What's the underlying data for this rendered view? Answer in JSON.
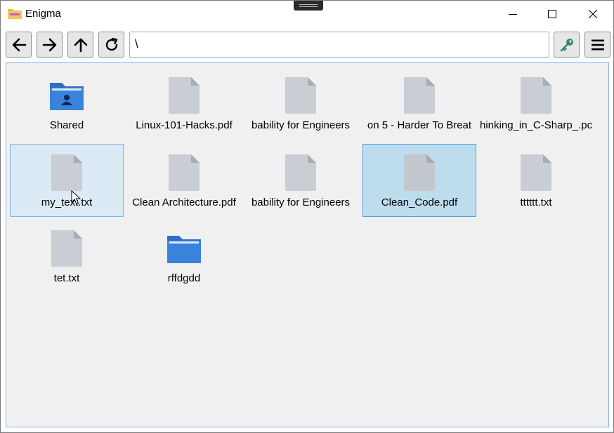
{
  "window": {
    "title": "Enigma"
  },
  "toolbar": {
    "path_value": "\\"
  },
  "items": [
    {
      "label": "Shared",
      "type": "folder-shared"
    },
    {
      "label": "Linux-101-Hacks.pdf",
      "type": "file"
    },
    {
      "label": "bability for Engineers",
      "type": "file"
    },
    {
      "label": "on 5 - Harder To Breat",
      "type": "file"
    },
    {
      "label": "hinking_in_C-Sharp_.pc",
      "type": "file"
    },
    {
      "label": "my_text.txt",
      "type": "file",
      "state": "hover"
    },
    {
      "label": "Clean Architecture.pdf",
      "type": "file"
    },
    {
      "label": "bability for Engineers",
      "type": "file"
    },
    {
      "label": "Clean_Code.pdf",
      "type": "file",
      "state": "selected"
    },
    {
      "label": "tttttt.txt",
      "type": "file"
    },
    {
      "label": "tet.txt",
      "type": "file"
    },
    {
      "label": "rffdgdd",
      "type": "folder"
    }
  ],
  "colors": {
    "folder": "#3a7ad6",
    "file": "#c8ccd3",
    "key_icon": "#3a8a6a",
    "selection": "#bddced",
    "hover": "#dbeaf4"
  },
  "icons": {
    "back": "arrow-left-icon",
    "forward": "arrow-right-icon",
    "up": "arrow-up-icon",
    "refresh": "refresh-icon",
    "key": "key-icon",
    "menu": "hamburger-menu-icon"
  }
}
